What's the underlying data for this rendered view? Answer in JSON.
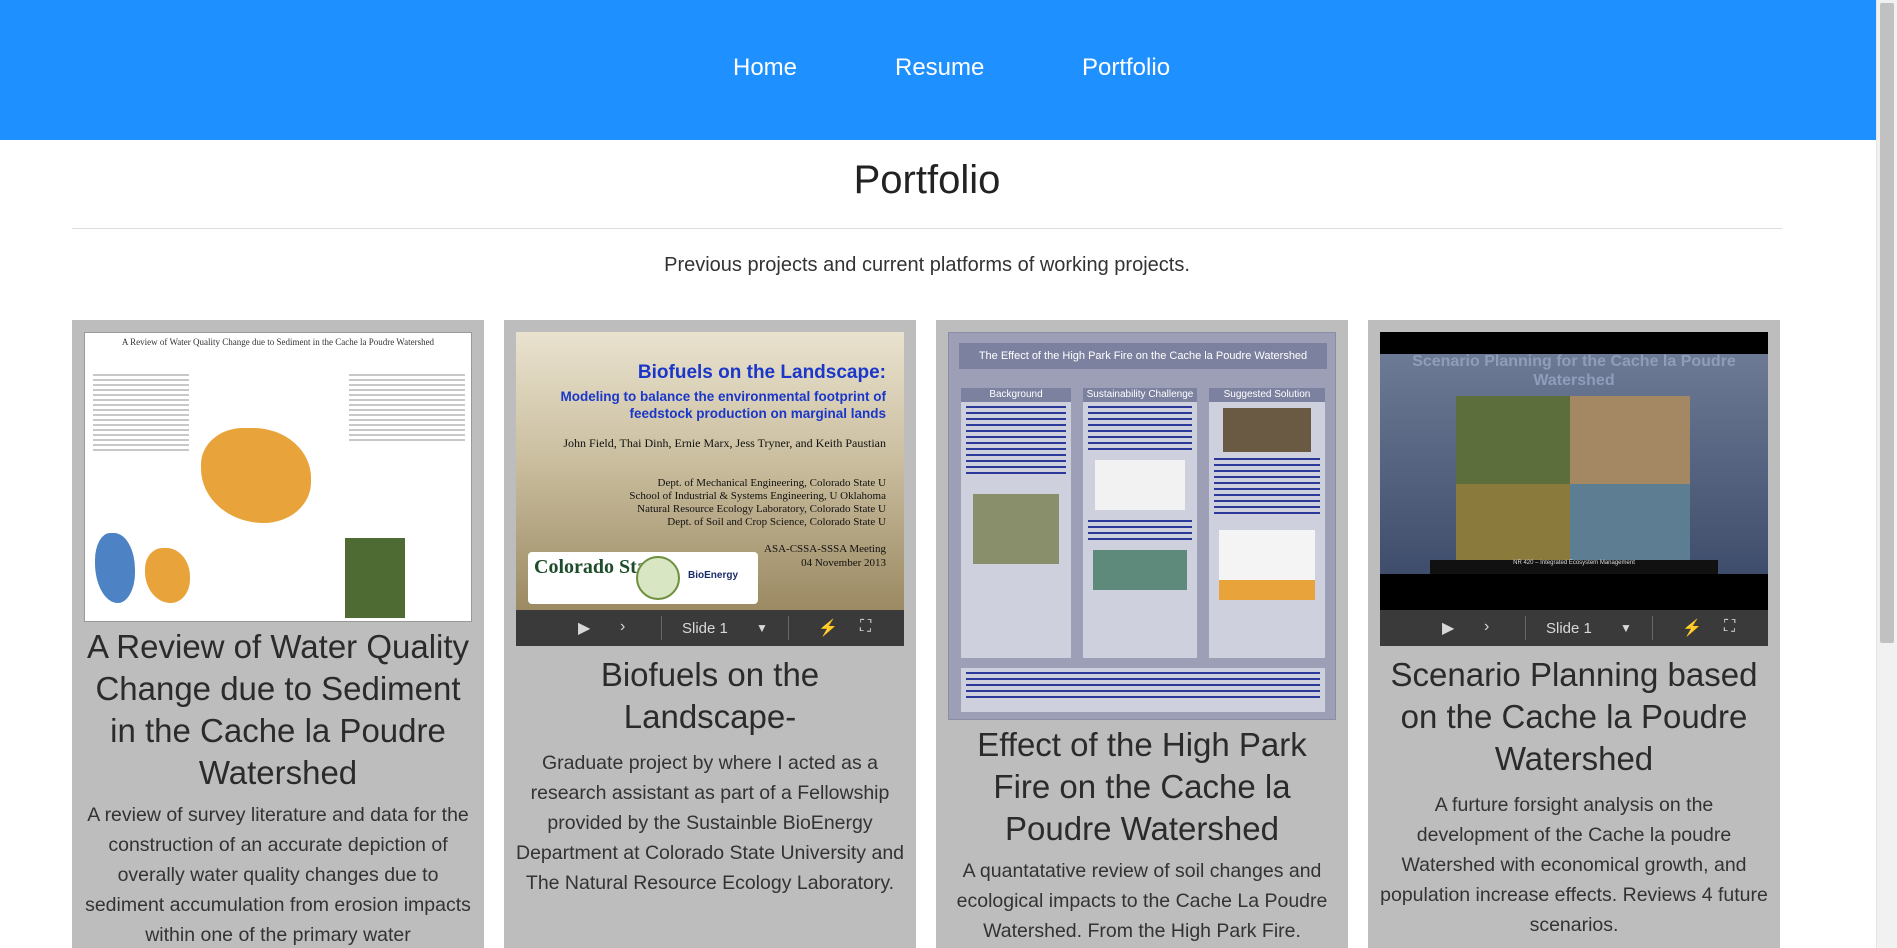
{
  "nav": {
    "home": "Home",
    "resume": "Resume",
    "portfolio": "Portfolio"
  },
  "page": {
    "title": "Portfolio",
    "subtitle": "Previous projects and current platforms of working projects."
  },
  "colors": {
    "navbar": "#1e90ff",
    "card_bg": "#bdbdbd"
  },
  "cards": [
    {
      "title": "A Review of Water Quality Change due to Sediment in the Cache la Poudre Watershed",
      "description": "A review of survey literature and data for the construction of an accurate depiction of overally water quality changes due to sediment accumulation from erosion impacts within one of the primary water",
      "thumb": {
        "title": "A Review of Water Quality Change due to Sediment in the Cache la Poudre Watershed"
      }
    },
    {
      "title": "Biofuels on the Landscape-",
      "description": "Graduate project by where I acted as a research assistant as part of a Fellowship provided by the Sustainble BioEnergy Department at Colorado State University and The Natural Resource Ecology Laboratory.",
      "thumb": {
        "title": "Biofuels on the Landscape:",
        "subtitle": "Modeling to balance the environmental footprint of feedstock production on marginal lands",
        "authors": "John Field, Thai Dinh, Ernie Marx, Jess Tryner, and Keith Paustian",
        "departments": [
          "Dept. of Mechanical Engineering, Colorado State U",
          "School of Industrial & Systems Engineering, U Oklahoma",
          "Natural Resource Ecology Laboratory, Colorado State U",
          "Dept. of Soil and Crop Science, Colorado State U"
        ],
        "meeting": "ASA-CSSA-SSSA Meeting",
        "date": "04 November 2013",
        "logo_csu": "Colorado State",
        "logo_bioenergy": "BioEnergy",
        "slide_label": "Slide 1"
      }
    },
    {
      "title": "Effect of the High Park Fire on the Cache la Poudre Watershed",
      "description": "A quantatative review of soil changes and ecological impacts to the Cache La Poudre Watershed. From the High Park Fire.",
      "thumb": {
        "title": "The Effect of the High Park Fire on the Cache la Poudre Watershed",
        "col_heads": [
          "Background",
          "Sustainability Challenge",
          "Suggested Solution"
        ]
      }
    },
    {
      "title": "Scenario Planning based on the Cache la Poudre Watershed",
      "description": "A furture forsight analysis on the development of the Cache la poudre Watershed with economical growth, and population increase effects. Reviews 4 future scenarios.",
      "thumb": {
        "title": "Scenario Planning for the Cache la Poudre Watershed",
        "caption": "NR 420 – Integrated Ecosystem Management",
        "slide_label": "Slide 1"
      }
    }
  ]
}
